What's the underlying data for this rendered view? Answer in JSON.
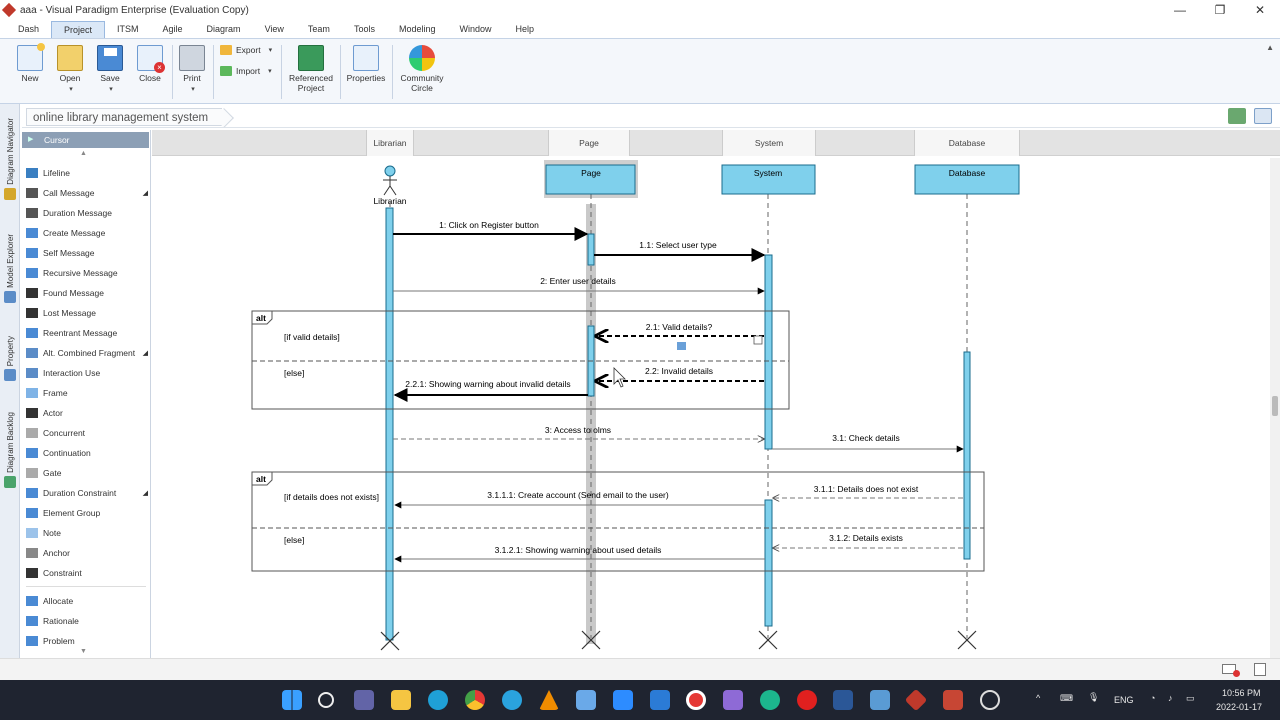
{
  "window": {
    "title": "aaa - Visual Paradigm Enterprise (Evaluation Copy)"
  },
  "menu": [
    "Dash",
    "Project",
    "ITSM",
    "Agile",
    "Diagram",
    "View",
    "Team",
    "Tools",
    "Modeling",
    "Window",
    "Help"
  ],
  "active_menu": "Project",
  "ribbon": {
    "new": "New",
    "open": "Open",
    "save": "Save",
    "close": "Close",
    "print": "Print",
    "export": "Export",
    "import": "Import",
    "referenced_project_1": "Referenced",
    "referenced_project_2": "Project",
    "properties": "Properties",
    "community_1": "Community",
    "community_2": "Circle"
  },
  "vtabs": [
    "Diagram Navigator",
    "Model Explorer",
    "Property",
    "Diagram Backlog"
  ],
  "breadcrumb": "online library management system",
  "palette": {
    "cursor": "Cursor",
    "items": [
      "Lifeline",
      "Call Message",
      "Duration Message",
      "Create Message",
      "Self Message",
      "Recursive Message",
      "Found Message",
      "Lost Message",
      "Reentrant Message",
      "Alt. Combined Fragment",
      "Interaction Use",
      "Frame",
      "Actor",
      "Concurrent",
      "Continuation",
      "Gate",
      "Duration Constraint",
      "Element Group",
      "Note",
      "Anchor",
      "Constraint"
    ],
    "items2": [
      "Allocate",
      "Rationale",
      "Problem"
    ]
  },
  "header_cells": [
    "Librarian",
    "Page",
    "System",
    "Database"
  ],
  "diagram": {
    "lifelines": {
      "librarian": "Librarian",
      "page": "Page",
      "system": "System",
      "database": "Database"
    },
    "messages": {
      "m1": "1: Click on Register button",
      "m11": "1.1: Select user type",
      "m2": "2: Enter user details",
      "m21": "2.1: Valid details?",
      "m22": "2.2: Invalid details",
      "m221": "2.2.1: Showing warning about invalid details",
      "m3": "3: Access to olms",
      "m31": "3.1: Check details",
      "m311": "3.1.1: Details does not exist",
      "m3111": "3.1.1.1: Create account (Send email to the user)",
      "m312": "3.1.2: Details exists",
      "m3121": "3.1.2.1: Showing warning about used details"
    },
    "fragments": {
      "alt1_label": "alt",
      "alt1_g1": "[if valid details]",
      "alt1_g2": "[else]",
      "alt2_label": "alt",
      "alt2_g1": "[if details does not exists]",
      "alt2_g2": "[else]"
    }
  },
  "tray": {
    "lang": "ENG",
    "time": "10:56 PM",
    "date": "2022-01-17"
  },
  "colors": {
    "lifeline_fill": "#7fd0ec",
    "lifeline_border": "#1a6b8c",
    "ribbon_bg": "#f4f7fb"
  }
}
